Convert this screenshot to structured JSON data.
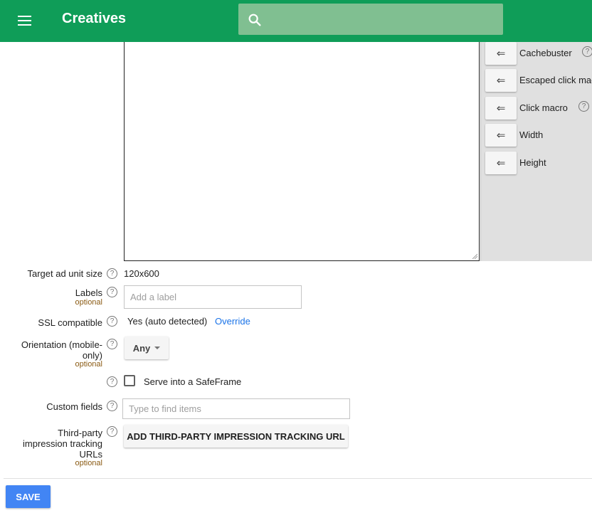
{
  "header": {
    "title": "Creatives",
    "search_placeholder": ""
  },
  "macros": [
    {
      "arrow": "⇐",
      "label": "Cachebuster",
      "has_help": true
    },
    {
      "arrow": "⇐",
      "label": "Escaped click macro",
      "has_help": false
    },
    {
      "arrow": "⇐",
      "label": "Click macro",
      "has_help": true
    },
    {
      "arrow": "⇐",
      "label": "Width",
      "has_help": false
    },
    {
      "arrow": "⇐",
      "label": "Height",
      "has_help": false
    }
  ],
  "help_glyph": "?",
  "form": {
    "target_ad_unit_size": {
      "label": "Target ad unit size",
      "value": "120x600"
    },
    "labels": {
      "label": "Labels",
      "optional": "optional",
      "placeholder": "Add a label"
    },
    "ssl": {
      "label": "SSL compatible",
      "value": "Yes (auto detected)",
      "link": "Override"
    },
    "orientation": {
      "label_line1": "Orientation (mobile-",
      "label_line2": "only)",
      "optional": "optional",
      "value": "Any"
    },
    "safeframe": {
      "label": "Serve into a SafeFrame",
      "checked": false
    },
    "custom_fields": {
      "label": "Custom fields",
      "placeholder": "Type to find items"
    },
    "tracking": {
      "label_line1": "Third-party",
      "label_line2": "impression tracking",
      "label_line3": "URLs",
      "optional": "optional",
      "button": "ADD THIRD-PARTY IMPRESSION TRACKING URL"
    }
  },
  "footer": {
    "save_label": "SAVE"
  },
  "colors": {
    "header_bg": "#0f9d58",
    "search_bg": "#80bf91",
    "link": "#1a73e8",
    "primary_button": "#4285f4",
    "optional_text": "#8a5a13"
  }
}
